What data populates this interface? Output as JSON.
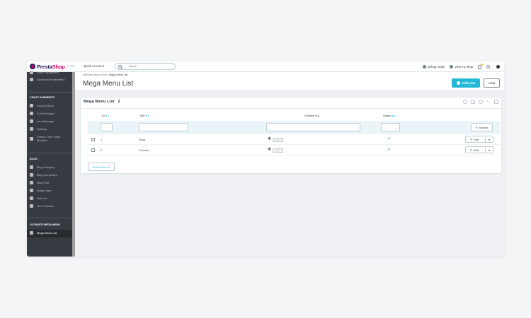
{
  "topbar": {
    "logo_a": "Presta",
    "logo_b": "Shop",
    "version": "1.7.8.5",
    "quick_access": "Quick Access ▾",
    "search_placeholder": "Search",
    "debug_mode": "Debug mode",
    "view_shop": "View my shop"
  },
  "sidebar": {
    "top_items": [
      "Shop Parameters",
      "Advanced Parameters"
    ],
    "crazy_heading": "CRAZY ELEMENTS",
    "crazy_items": [
      "Crazy Editors",
      "Font Manager",
      "Icon Manager",
      "Settings",
      "Extend Third Party",
      "Modules"
    ],
    "blog_heading": "BLOG",
    "blog_items": [
      "Blog Category",
      "Blog Comments",
      "Blog Post",
      "Image Type",
      "Add-ons",
      "Our Products"
    ],
    "umm_heading": "ULTIMATE MEGA MENU",
    "umm_items": [
      "Mega Menu List"
    ]
  },
  "header": {
    "breadcrumb_parent": "Ultimate Mega Menu",
    "breadcrumb_sep": "/",
    "breadcrumb_current": "Mega Menu List",
    "title": "Mega Menu List",
    "add_new": "Add new",
    "help": "Help"
  },
  "panel": {
    "title": "Mega Menu List",
    "count": "2",
    "columns": {
      "id": "ID",
      "title": "Title",
      "position": "Position",
      "status": "Status"
    },
    "status_filter_value": "--",
    "search_btn": "Search",
    "bulk_actions": "Bulk actions ▴"
  },
  "rows": [
    {
      "id": "1",
      "title": "Shop",
      "position": "1",
      "status": "✔",
      "edit": "Edit"
    },
    {
      "id": "2",
      "title": "Contact",
      "position": "2",
      "status": "✔",
      "edit": "Edit"
    }
  ],
  "colors": {
    "accent": "#25b9d7",
    "sidebar": "#363a41",
    "brand_pink": "#df0067"
  }
}
